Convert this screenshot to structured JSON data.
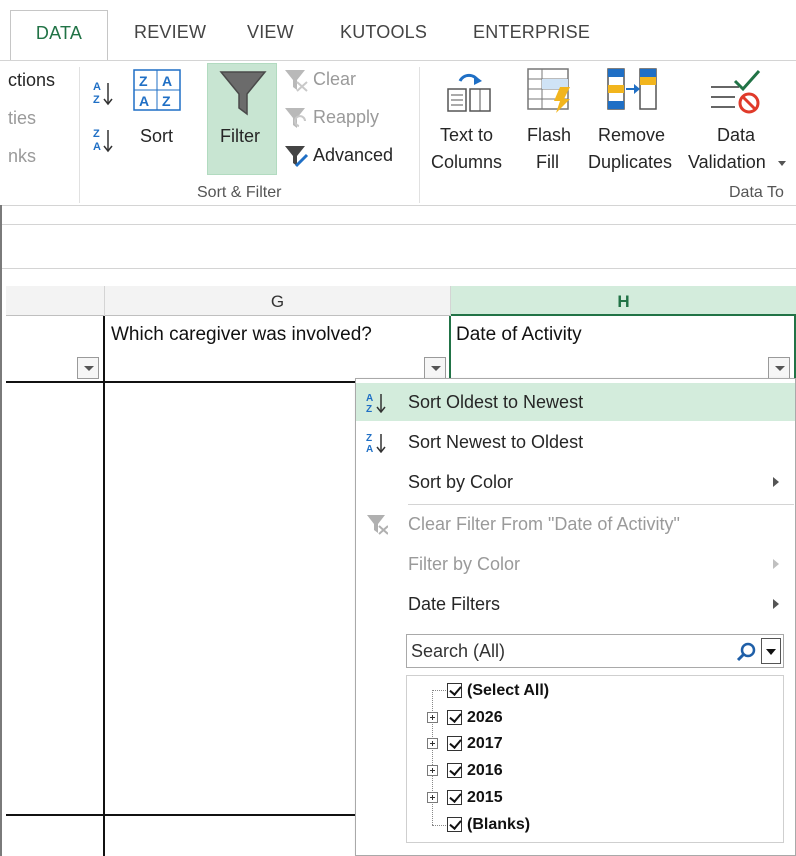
{
  "tabs": [
    {
      "label": "DATA",
      "active": true
    },
    {
      "label": "REVIEW"
    },
    {
      "label": "VIEW"
    },
    {
      "label": "KUTOOLS"
    },
    {
      "label": "ENTERPRISE"
    }
  ],
  "ribbon": {
    "partial_left": [
      "ctions",
      "ties",
      "nks"
    ],
    "sort_label": "Sort",
    "filter_label": "Filter",
    "clear_label": "Clear",
    "reapply_label": "Reapply",
    "advanced_label": "Advanced",
    "sort_filter_group": "Sort & Filter",
    "text_to_columns": [
      "Text to",
      "Columns"
    ],
    "flash_fill": [
      "Flash",
      "Fill"
    ],
    "remove_duplicates": [
      "Remove",
      "Duplicates"
    ],
    "data_validation": [
      "Data",
      "Validation"
    ],
    "data_tools_group": "Data To",
    "accent": "#217346"
  },
  "sheet": {
    "col_g": "G",
    "col_h": "H",
    "g_header": "Which caregiver was involved?",
    "h_header": "Date of Activity"
  },
  "menu": {
    "items": [
      {
        "label": "Sort Oldest to Newest",
        "icon": "sort-asc-icon",
        "highlighted": true
      },
      {
        "label": "Sort Newest to Oldest",
        "icon": "sort-desc-icon"
      },
      {
        "label": "Sort by Color",
        "submenu": true
      },
      {
        "label": "Clear Filter From \"Date of Activity\"",
        "icon": "clear-filter-icon",
        "disabled": true
      },
      {
        "label": "Filter by Color",
        "submenu": true,
        "disabled": true
      },
      {
        "label": "Date Filters",
        "submenu": true
      }
    ],
    "search_placeholder": "Search (All)",
    "tree": [
      {
        "label": "(Select All)",
        "checked": true
      },
      {
        "label": "2026",
        "checked": true,
        "expandable": true
      },
      {
        "label": "2017",
        "checked": true,
        "expandable": true
      },
      {
        "label": "2016",
        "checked": true,
        "expandable": true
      },
      {
        "label": "2015",
        "checked": true,
        "expandable": true
      },
      {
        "label": "(Blanks)",
        "checked": true
      }
    ]
  }
}
